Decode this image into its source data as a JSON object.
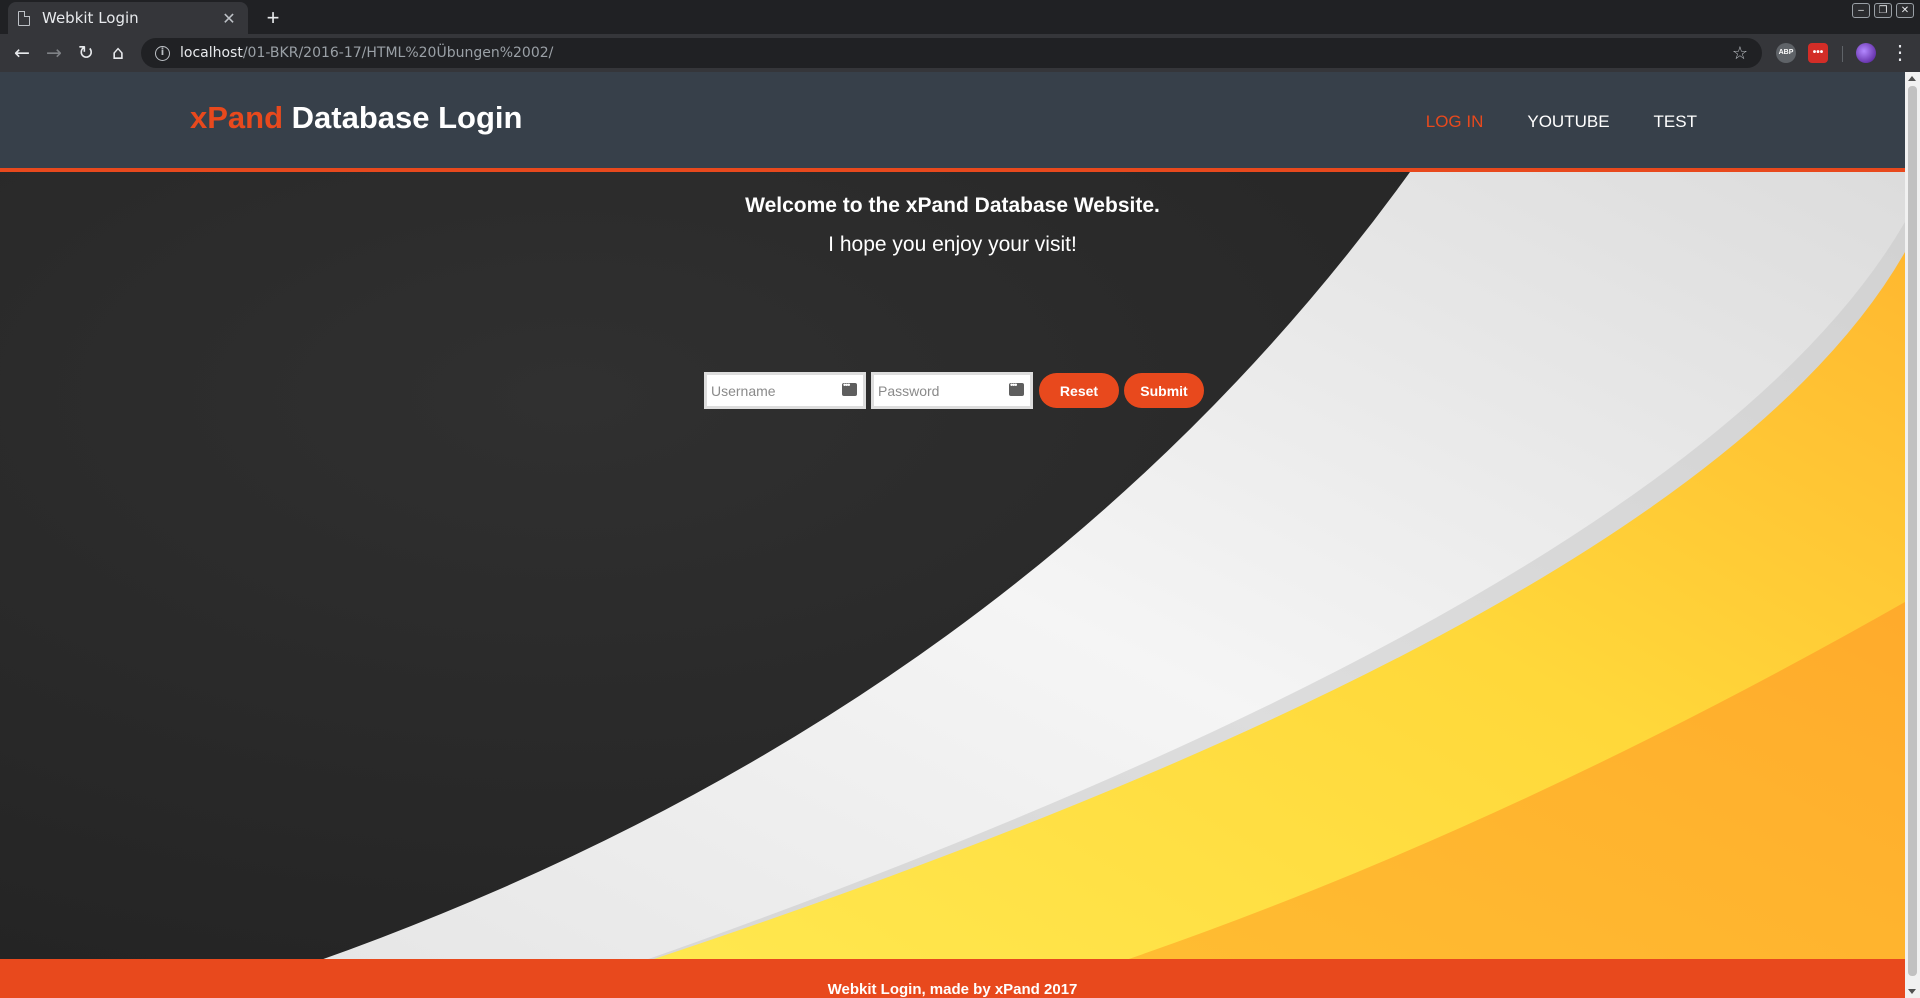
{
  "browser": {
    "tab_title": "Webkit Login",
    "url_host": "localhost",
    "url_path": "/01-BKR/2016-17/HTML%20Übungen%2002/"
  },
  "site": {
    "brand_accent": "xPand",
    "brand_rest": " Database Login",
    "nav": [
      {
        "label": "LOG IN",
        "active": true
      },
      {
        "label": "YOUTUBE",
        "active": false
      },
      {
        "label": "TEST",
        "active": false
      }
    ],
    "welcome_title": "Welcome to the xPand Database Website.",
    "welcome_subtitle": "I hope you enjoy your visit!",
    "form": {
      "username_placeholder": "Username",
      "password_placeholder": "Password",
      "reset_label": "Reset",
      "submit_label": "Submit"
    },
    "footer_text": "Webkit Login, made by xPand 2017"
  },
  "colors": {
    "accent": "#e8491d",
    "header_bg": "#37404a",
    "body_dark": "#2b2b2b",
    "swoosh_white": "#f2f2f2",
    "swoosh_yellow": "#ffe24d",
    "swoosh_orange": "#ffab2e"
  }
}
